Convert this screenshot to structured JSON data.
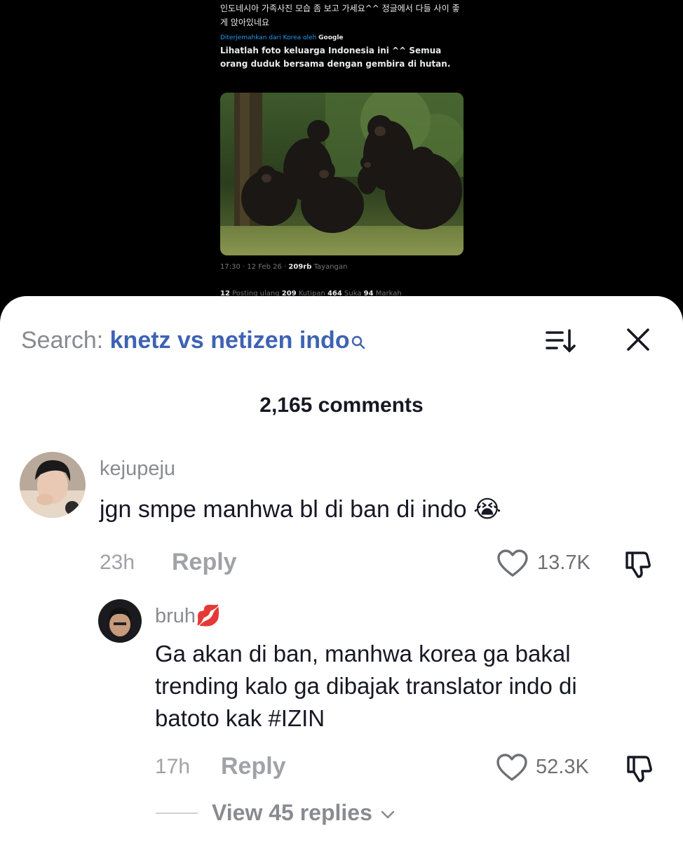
{
  "tweet": {
    "korean_text": "인도네시아 가족사진 모습 좀 보고 가세요^^ 정글에서 다들 사이 좋게 앉아있네요",
    "translated_label": "Diterjemahkan dari Korea oleh",
    "translated_provider": "Google",
    "indonesian_text": "Lihatlah foto keluarga Indonesia ini ^^ Semua orang duduk bersama dengan gembira di hutan.",
    "time": "17:30 · 12 Feb 26 ·",
    "views_count": "209rb",
    "views_label": "Tayangan",
    "stats": {
      "reposts_count": "12",
      "reposts_label": "Posting ulang",
      "quotes_count": "209",
      "quotes_label": "Kutipan",
      "likes_count": "464",
      "likes_label": "Suka",
      "bookmarks_count": "94",
      "bookmarks_label": "Markah"
    }
  },
  "header": {
    "search_label": "Search:",
    "search_query": "knetz vs netizen indo",
    "icons": {
      "search": "search-icon",
      "sort": "sort-icon",
      "close": "close-icon"
    }
  },
  "comments_count": "2,165 comments",
  "comments": [
    {
      "username": "kejupeju",
      "text": "jgn smpe manhwa bl di ban di indo 😭",
      "time": "23h",
      "reply_label": "Reply",
      "likes": "13.7K"
    }
  ],
  "replies": [
    {
      "username": "bruh💋",
      "text_lines": [
        "Ga akan di ban, manhwa korea ga bakal",
        "trending kalo ga dibajak translator indo di",
        "batoto kak #IZIN"
      ],
      "time": "17h",
      "reply_label": "Reply",
      "likes": "52.3K"
    }
  ],
  "view_more_label": "View 45 replies",
  "colors": {
    "accent": "#3d63b3",
    "text": "#161823",
    "muted": "#a1a2a7",
    "background": "#ffffff"
  }
}
